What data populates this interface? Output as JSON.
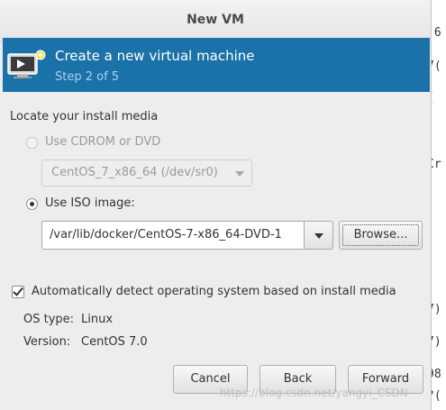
{
  "window": {
    "title": "New VM"
  },
  "banner": {
    "heading": "Create a new virtual machine",
    "step": "Step 2 of 5"
  },
  "install_media": {
    "section_label": "Locate your install media",
    "cdrom": {
      "label": "Use CDROM or DVD",
      "selected": false,
      "enabled": false,
      "device": "CentOS_7_x86_64 (/dev/sr0)"
    },
    "iso": {
      "label": "Use ISO image:",
      "selected": true,
      "path": "/var/lib/docker/CentOS-7-x86_64-DVD-1",
      "browse_label": "Browse..."
    }
  },
  "detect": {
    "label": "Automatically detect operating system based on install media",
    "checked": true,
    "os_type_label": "OS type:",
    "os_type_value": "Linux",
    "version_label": "Version:",
    "version_value": "CentOS 7.0"
  },
  "buttons": {
    "cancel": "Cancel",
    "back": "Back",
    "forward": "Forward"
  },
  "background_fragments": [
    ":6",
    "7(",
    "(",
    "Cr",
    "7)",
    "7)",
    "98",
    "?("
  ],
  "watermark": "https://blog.csdn.net/yangyi_CSDN"
}
